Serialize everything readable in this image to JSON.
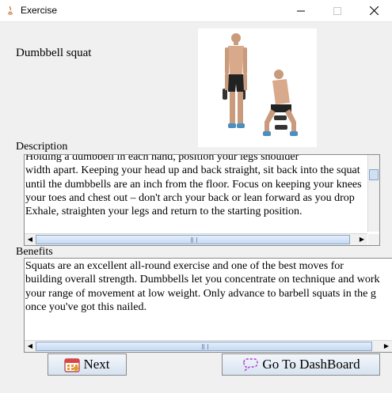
{
  "window": {
    "title": "Exercise"
  },
  "exercise": {
    "name": "Dumbbell squat",
    "image_alt": "Man performing dumbbell squat"
  },
  "description": {
    "label": "Description",
    "text": "Holding a dumbbell in each hand, position your legs shoulder\nwidth apart. Keeping your head up and back straight, sit back into the squat\nuntil the dumbbells are an inch from the floor. Focus on keeping your knees\nyour toes and chest out – don't arch your back or lean forward as you drop\nExhale, straighten your legs and return to the starting position."
  },
  "benefits": {
    "label": "Benefits",
    "text": "Squats are an excellent all-round exercise and one of the best moves for\nbuilding overall strength. Dumbbells let you concentrate on technique and work\nyour range of movement at low weight. Only advance to barbell squats in the g\nonce you've got this nailed."
  },
  "buttons": {
    "next": "Next",
    "dashboard": "Go To DashBoard"
  },
  "icons": {
    "app": "java-icon",
    "next": "calendar-icon",
    "dashboard": "dashboard-icon"
  },
  "colors": {
    "titlebar_bg": "#ffffff",
    "window_bg": "#f0f0f0",
    "button_bg": "#d7e3f1"
  }
}
